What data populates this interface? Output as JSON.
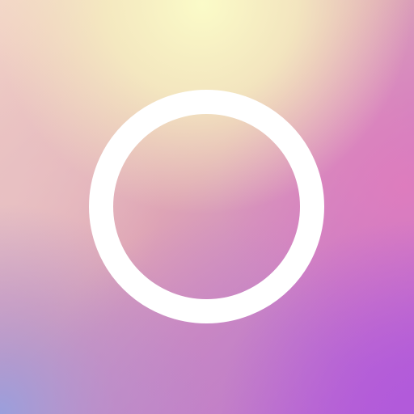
{
  "app_icon": {
    "icon": "ring-icon",
    "colors": {
      "ring": "#ffffff",
      "top_glow": "#fbfbc8",
      "upper_left": "#f3d6c8",
      "center": "#dea4b5",
      "right": "#e07cbd",
      "bottom_left": "#9a9fdc",
      "bottom_right": "#b25ada",
      "bottom_middle": "#c184c6"
    }
  }
}
